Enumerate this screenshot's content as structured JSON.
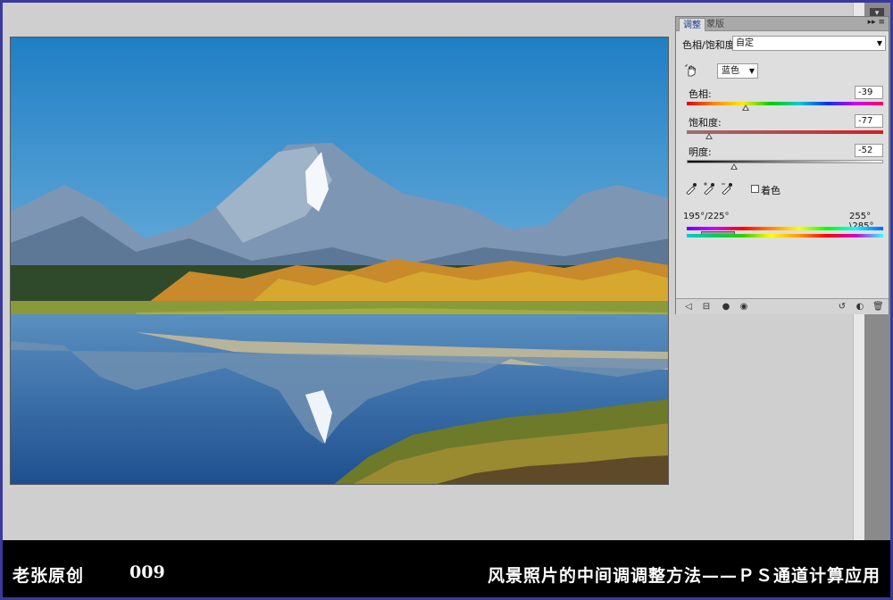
{
  "window": {
    "corner_button": "▾"
  },
  "adjustments_panel": {
    "tabs": [
      {
        "label": "调整"
      },
      {
        "label": "蒙版"
      }
    ],
    "menu_icons": "▸▸ ≡",
    "preset_label": "色相/饱和度",
    "preset_value": "自定",
    "channel_value": "蓝色",
    "hue": {
      "label": "色相:",
      "value": "-39",
      "fraction": 0.3
    },
    "saturation": {
      "label": "饱和度:",
      "value": "-77",
      "fraction": 0.115
    },
    "lightness": {
      "label": "明度:",
      "value": "-52",
      "fraction": 0.24
    },
    "colorize_label": "着色",
    "range_left": "195°/225°",
    "range_right": "255°\\285°",
    "bottom_icons": [
      "◁",
      "⊟",
      "●",
      "◉",
      "↺",
      "◐",
      "🗑"
    ]
  },
  "caption": {
    "author": "老张原创",
    "number": "009",
    "title": "风景照片的中间调调整方法——ＰＳ通道计算应用"
  },
  "colors": {
    "frame": "#3a3a9a",
    "panel_bg": "#dedede",
    "workspace": "#cfcfcf"
  }
}
